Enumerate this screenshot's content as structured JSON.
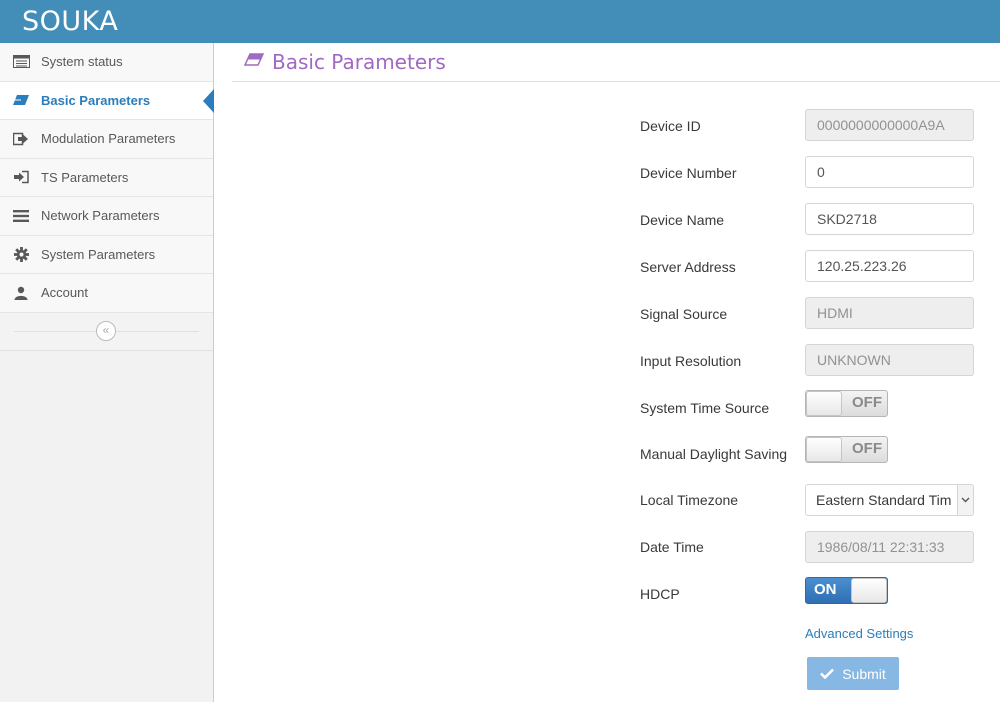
{
  "app": {
    "brand": "SOUKA"
  },
  "sidebar": {
    "items": [
      {
        "label": "System status",
        "icon": "list-icon"
      },
      {
        "label": "Basic Parameters",
        "icon": "eraser-icon",
        "active": true
      },
      {
        "label": "Modulation Parameters",
        "icon": "sign-out-icon"
      },
      {
        "label": "TS Parameters",
        "icon": "sign-in-icon"
      },
      {
        "label": "Network Parameters",
        "icon": "menu-icon"
      },
      {
        "label": "System Parameters",
        "icon": "gear-icon"
      },
      {
        "label": "Account",
        "icon": "user-icon"
      }
    ],
    "collapse_icon": "double-chevron-left-icon"
  },
  "page": {
    "title": "Basic Parameters",
    "title_icon": "eraser-icon"
  },
  "form": {
    "device_id": {
      "label": "Device ID",
      "value": "0000000000000A9A"
    },
    "device_number": {
      "label": "Device Number",
      "value": "0"
    },
    "device_name": {
      "label": "Device Name",
      "value": "SKD2718"
    },
    "server_address": {
      "label": "Server Address",
      "value": "120.25.223.26"
    },
    "signal_source": {
      "label": "Signal Source",
      "value": "HDMI"
    },
    "input_resolution": {
      "label": "Input Resolution",
      "value": "UNKNOWN"
    },
    "system_time_source": {
      "label": "System Time Source",
      "state": "OFF"
    },
    "manual_daylight_saving": {
      "label": "Manual Daylight Saving",
      "state": "OFF"
    },
    "local_timezone": {
      "label": "Local Timezone",
      "value": "Eastern Standard Tim"
    },
    "date_time": {
      "label": "Date Time",
      "value": "1986/08/11 22:31:33"
    },
    "hdcp": {
      "label": "HDCP",
      "state": "ON"
    },
    "advanced_link": "Advanced Settings",
    "submit_label": "Submit"
  },
  "colors": {
    "brand_bar": "#438eb9",
    "accent": "#2b7dbc",
    "title": "#a069c3",
    "submit": "#87b7e3"
  }
}
